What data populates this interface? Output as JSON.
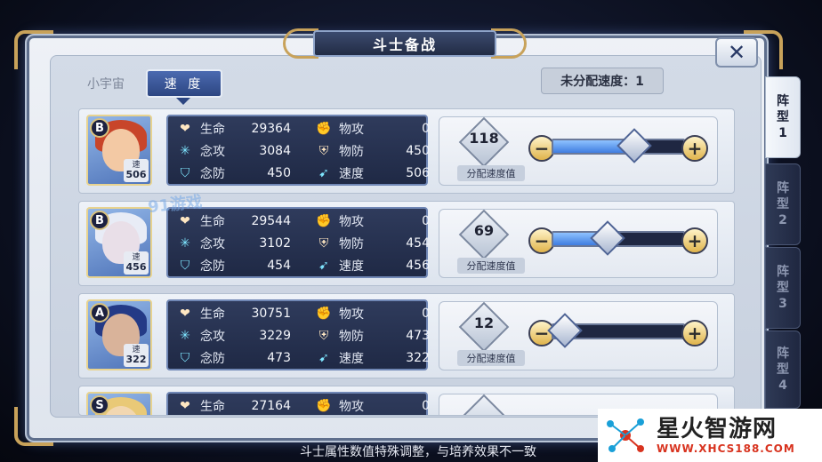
{
  "title": "斗士备战",
  "close_label": "✕",
  "tabs": [
    {
      "label": "小宇宙",
      "active": false
    },
    {
      "label": "速 度",
      "active": true
    }
  ],
  "unassigned": {
    "label": "未分配速度：1"
  },
  "formations": [
    {
      "line1": "阵",
      "line2": "型",
      "line3": "1",
      "active": true
    },
    {
      "line1": "阵",
      "line2": "型",
      "line3": "2",
      "active": false
    },
    {
      "line1": "阵",
      "line2": "型",
      "line3": "3",
      "active": false
    },
    {
      "line1": "阵",
      "line2": "型",
      "line3": "4",
      "active": false
    }
  ],
  "stat_labels": {
    "hp": "生命",
    "matk": "念攻",
    "mdef": "念防",
    "patk": "物攻",
    "pdef": "物防",
    "speed": "速度"
  },
  "alloc_label": "分配速度值",
  "badge_label": "速",
  "fighters": [
    {
      "grade": "B",
      "badge_speed": "506",
      "hp": "29364",
      "matk": "3084",
      "mdef": "450",
      "patk": "0",
      "pdef": "450",
      "speed": "506",
      "alloc": "118",
      "fill": 0.62,
      "hair": "#c8452a",
      "face": "#f3c9a4"
    },
    {
      "grade": "B",
      "badge_speed": "456",
      "hp": "29544",
      "matk": "3102",
      "mdef": "454",
      "patk": "0",
      "pdef": "454",
      "speed": "456",
      "alloc": "69",
      "fill": 0.42,
      "hair": "#e8ecf6",
      "face": "#e9dfe8"
    },
    {
      "grade": "A",
      "badge_speed": "322",
      "hp": "30751",
      "matk": "3229",
      "mdef": "473",
      "patk": "0",
      "pdef": "473",
      "speed": "322",
      "alloc": "12",
      "fill": 0.1,
      "hair": "#243a86",
      "face": "#d9b39a"
    },
    {
      "grade": "S",
      "badge_speed": "",
      "hp": "27164",
      "matk": "",
      "mdef": "",
      "patk": "0",
      "pdef": "",
      "speed": "",
      "alloc": "",
      "fill": 0.3,
      "hair": "#e9c977",
      "face": "#f2d7b1"
    }
  ],
  "footer_note": "斗士属性数值特殊调整，与培养效果不一致",
  "watermark": "91游戏",
  "brand": {
    "title": "星火智游网",
    "url": "WWW.XHCS188.COM"
  }
}
